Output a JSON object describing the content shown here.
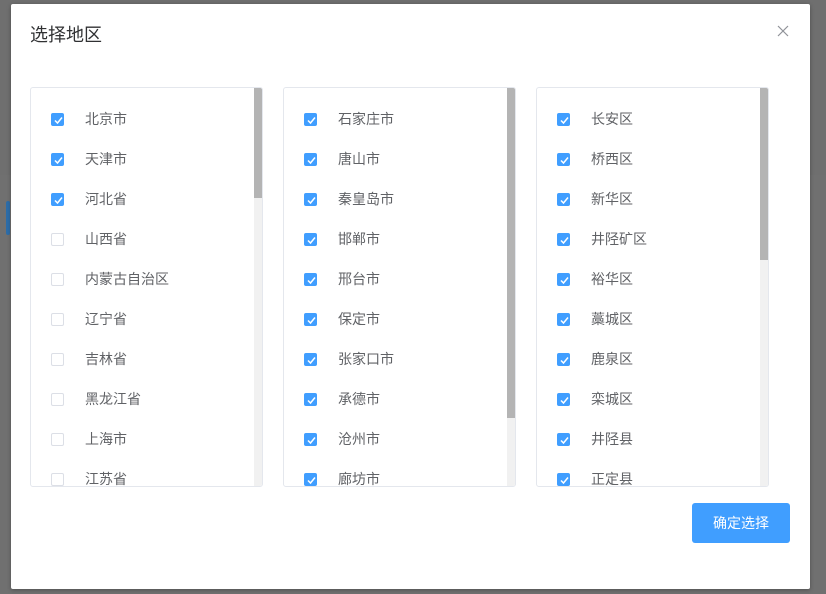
{
  "dialog": {
    "title": "选择地区",
    "confirm_label": "确定选择"
  },
  "provinces": [
    {
      "label": "北京市",
      "checked": true
    },
    {
      "label": "天津市",
      "checked": true
    },
    {
      "label": "河北省",
      "checked": true
    },
    {
      "label": "山西省",
      "checked": false
    },
    {
      "label": "内蒙古自治区",
      "checked": false
    },
    {
      "label": "辽宁省",
      "checked": false
    },
    {
      "label": "吉林省",
      "checked": false
    },
    {
      "label": "黑龙江省",
      "checked": false
    },
    {
      "label": "上海市",
      "checked": false
    },
    {
      "label": "江苏省",
      "checked": false
    }
  ],
  "cities": [
    {
      "label": "石家庄市",
      "checked": true
    },
    {
      "label": "唐山市",
      "checked": true
    },
    {
      "label": "秦皇岛市",
      "checked": true
    },
    {
      "label": "邯郸市",
      "checked": true
    },
    {
      "label": "邢台市",
      "checked": true
    },
    {
      "label": "保定市",
      "checked": true
    },
    {
      "label": "张家口市",
      "checked": true
    },
    {
      "label": "承德市",
      "checked": true
    },
    {
      "label": "沧州市",
      "checked": true
    },
    {
      "label": "廊坊市",
      "checked": true
    }
  ],
  "districts": [
    {
      "label": "长安区",
      "checked": true
    },
    {
      "label": "桥西区",
      "checked": true
    },
    {
      "label": "新华区",
      "checked": true
    },
    {
      "label": "井陉矿区",
      "checked": true
    },
    {
      "label": "裕华区",
      "checked": true
    },
    {
      "label": "藁城区",
      "checked": true
    },
    {
      "label": "鹿泉区",
      "checked": true
    },
    {
      "label": "栾城区",
      "checked": true
    },
    {
      "label": "井陉县",
      "checked": true
    },
    {
      "label": "正定县",
      "checked": true
    }
  ],
  "icons": {
    "close": "close-icon",
    "check": "check-icon"
  },
  "colors": {
    "accent": "#409eff",
    "text": "#606266",
    "title": "#303133",
    "border": "#e4e7ed"
  }
}
